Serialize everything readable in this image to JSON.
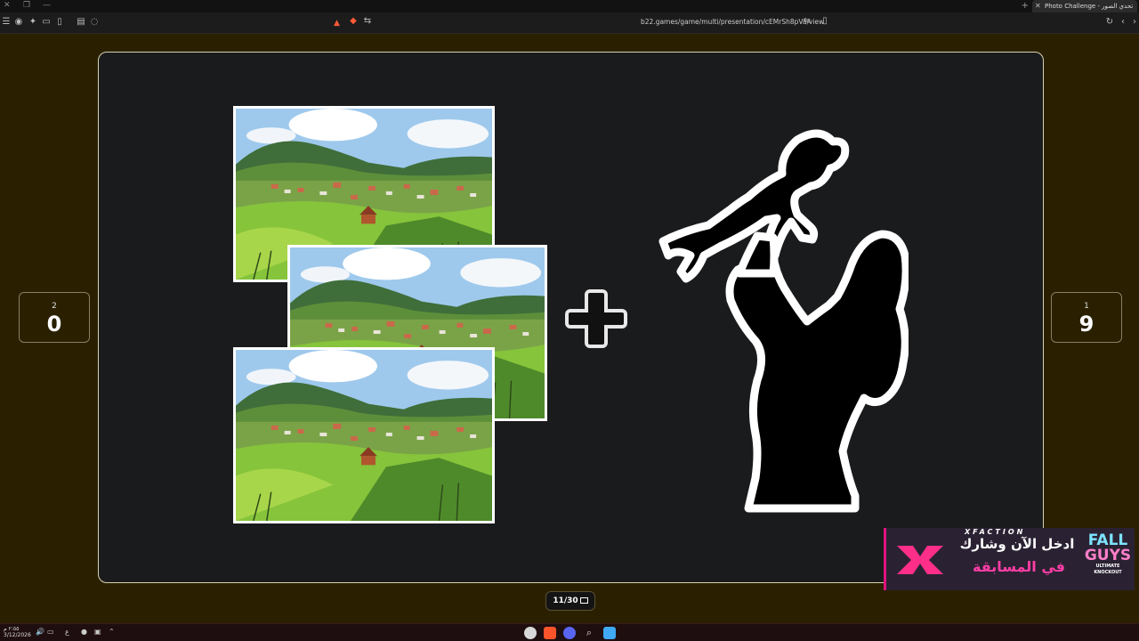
{
  "browser": {
    "tab_title": "Photo Challenge - تحدي الصور",
    "url": "b22.games/game/multi/presentation/cEMrSh8pVa/view",
    "new_tab": "+"
  },
  "scores": {
    "left": {
      "team": "2",
      "points": "0"
    },
    "right": {
      "team": "1",
      "points": "9"
    }
  },
  "counter": {
    "label": "11/30"
  },
  "ad": {
    "brand": "XFACTION",
    "line1": "ادخل الآن وشارك",
    "line2": "في المسابقة",
    "fall": "FALL",
    "guys": "GUYS",
    "sub": "ULTIMATE KNOCKOUT"
  },
  "taskbar": {
    "time": "٢:٥٥ م",
    "date": "3/12/2026",
    "lang": "ع"
  },
  "icons": {
    "menu": "menu-icon",
    "plus": "plus-icon",
    "silhouette": "mother-baby-silhouette-icon"
  },
  "colors": {
    "page_bg": "#2a2000",
    "stage_bg": "#1a1b1d",
    "ad_accent": "#e0137e"
  }
}
